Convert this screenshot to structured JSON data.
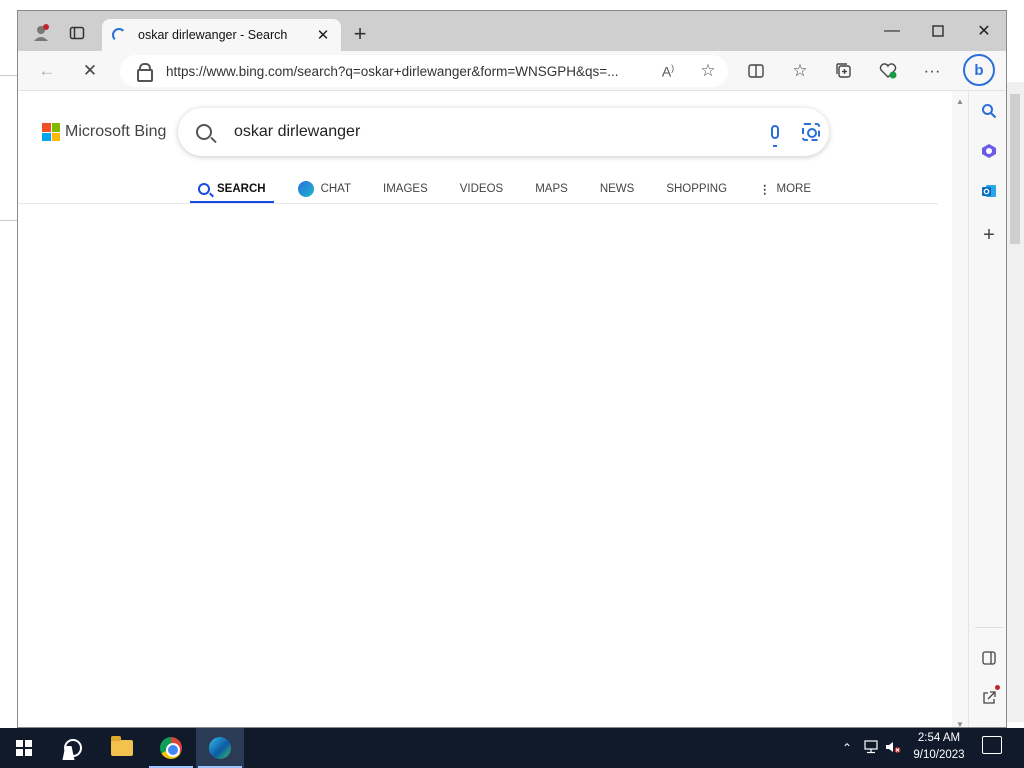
{
  "browser": {
    "tab": {
      "title": "oskar dirlewanger - Search"
    },
    "address": {
      "url": "https://www.bing.com/search?q=oskar+dirlewanger&form=WNSGPH&qs=..."
    }
  },
  "bing": {
    "logo_text": "Microsoft Bing",
    "query": "oskar dirlewanger",
    "nav": [
      {
        "label": "SEARCH",
        "active": true
      },
      {
        "label": "CHAT"
      },
      {
        "label": "IMAGES"
      },
      {
        "label": "VIDEOS"
      },
      {
        "label": "MAPS"
      },
      {
        "label": "NEWS"
      },
      {
        "label": "SHOPPING"
      },
      {
        "label": "MORE"
      }
    ],
    "colors": {
      "accent": "#174ae4",
      "ms_red": "#f25022",
      "ms_green": "#7fba00",
      "ms_blue": "#00a4ef",
      "ms_yellow": "#ffb900"
    }
  },
  "taskbar": {
    "time": "2:54 AM",
    "date": "9/10/2023",
    "apps": [
      "start-icon",
      "search-icon",
      "file-explorer-icon",
      "chrome-icon",
      "edge-icon"
    ]
  }
}
